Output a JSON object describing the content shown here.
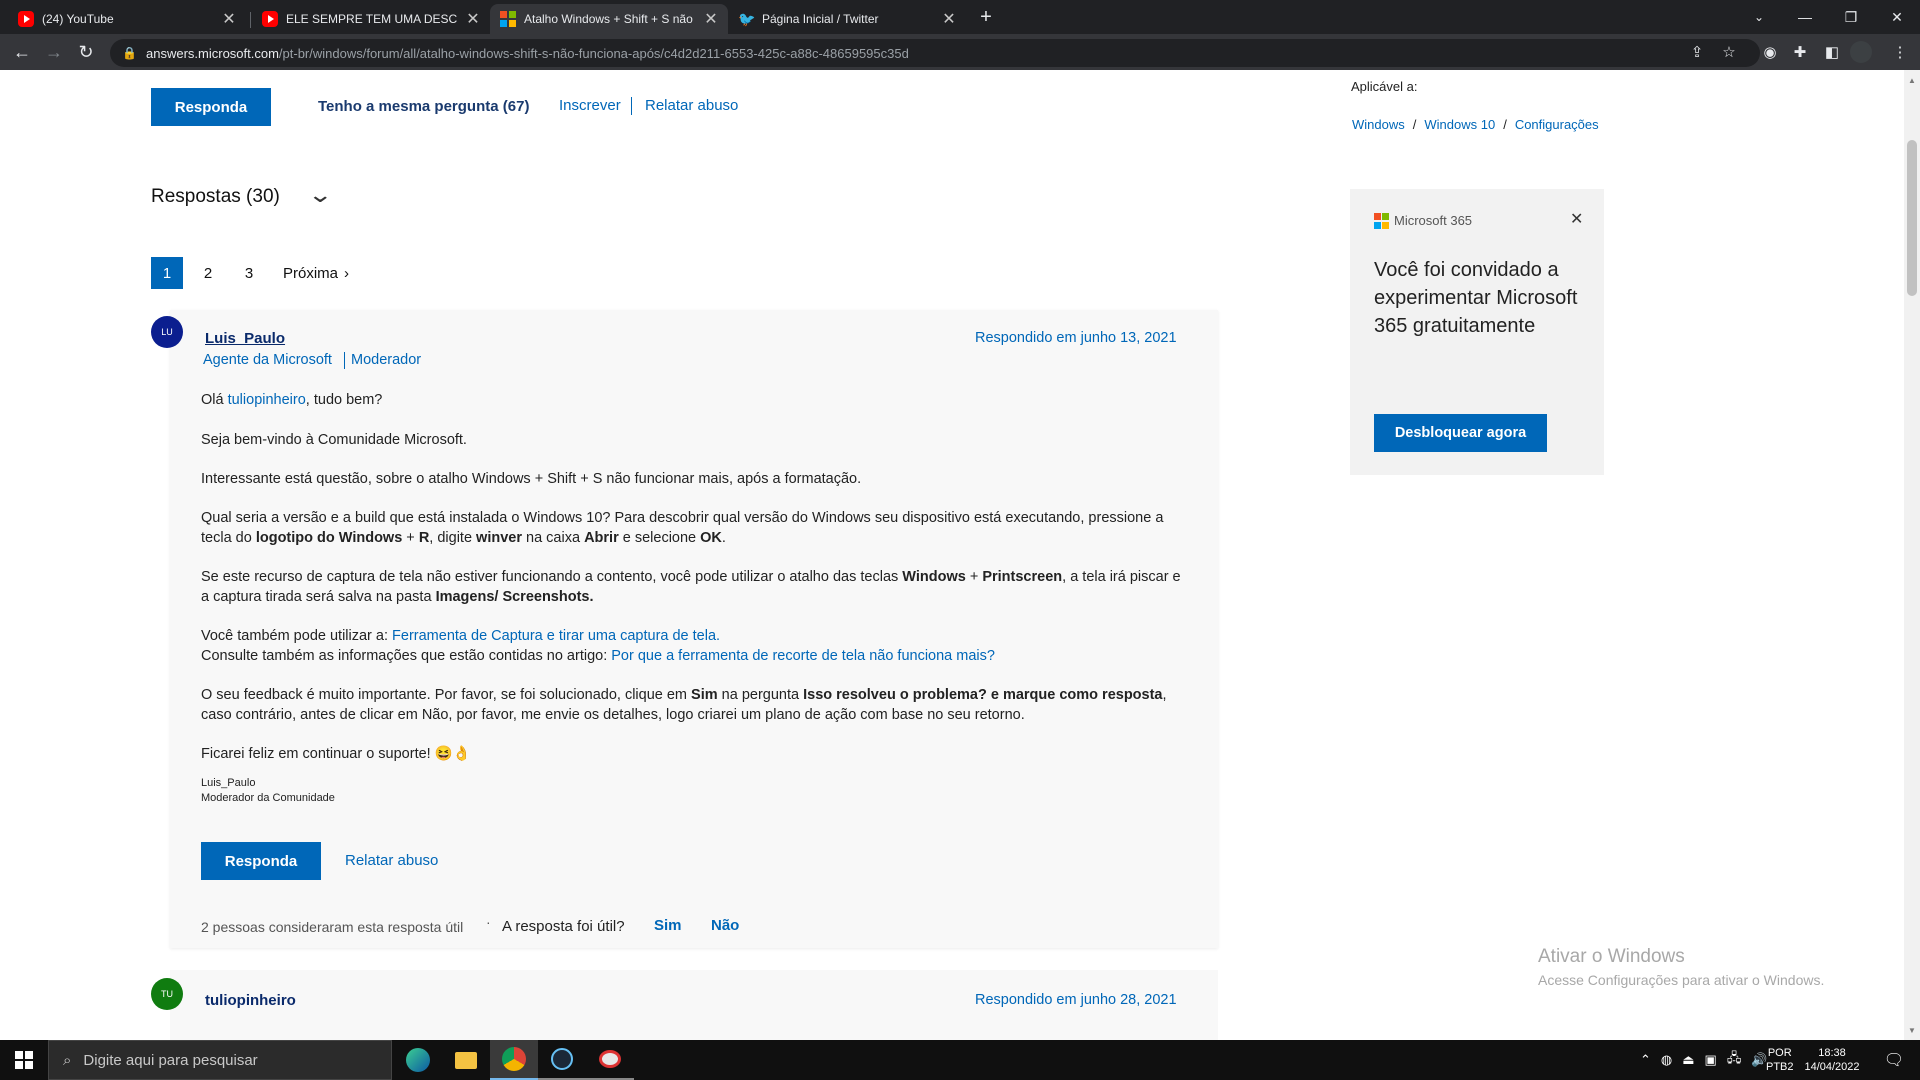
{
  "browser": {
    "tabs": [
      {
        "title": "(24) YouTube",
        "icon": "youtube-icon"
      },
      {
        "title": "ELE SEMPRE TEM UMA DESCULPA",
        "icon": "youtube-icon"
      },
      {
        "title": "Atalho Windows + Shift + S não funciona após",
        "icon": "microsoft-icon"
      },
      {
        "title": "Página Inicial / Twitter",
        "icon": "twitter-icon"
      }
    ],
    "url_host": "answers.microsoft.com",
    "url_path": "/pt-br/windows/forum/all/atalho-windows-shift-s-não-funciona-após/c4d2d211-6553-425c-a88c-48659595c35d"
  },
  "question_actions": {
    "reply": "Responda",
    "same_question": "Tenho a mesma pergunta (67)",
    "subscribe": "Inscrever",
    "report": "Relatar abuso"
  },
  "sidebar": {
    "applies_to": "Aplicável a:",
    "breadcrumbs": [
      "Windows",
      "Windows 10",
      "Configurações"
    ],
    "ad": {
      "brand": "Microsoft 365",
      "headline": "Você foi convidado a experimentar Microsoft 365 gratuitamente",
      "cta": "Desbloquear agora"
    }
  },
  "replies": {
    "heading": "Respostas (30)",
    "pages": [
      "1",
      "2",
      "3"
    ],
    "next": "Próxima"
  },
  "post1": {
    "avatar": "LU",
    "author": "Luis_Paulo",
    "role_agent": "Agente da Microsoft",
    "role_mod": "Moderador",
    "date": "Respondido em junho 13, 2021",
    "greeting_pre": "Olá ",
    "greeting_user": "tuliopinheiro",
    "greeting_post": ", tudo bem?",
    "p_welcome": "Seja bem-vindo à Comunidade Microsoft.",
    "p_interest": "Interessante está questão, sobre o atalho Windows + Shift + S não funcionar mais, após a formatação.",
    "p_version_1": "Qual seria a versão e a build que está instalada o Windows 10? Para descobrir qual versão do Windows seu dispositivo está executando, pressione a tecla do ",
    "p_version_b1": "logotipo do Windows",
    "p_version_2": "  + ",
    "p_version_b2": "R",
    "p_version_3": ", digite ",
    "p_version_b3": "winver",
    "p_version_4": " na caixa ",
    "p_version_b4": "Abrir",
    "p_version_5": " e selecione ",
    "p_version_b5": "OK",
    "p_version_6": ".",
    "p_capture_1": "Se este recurso de captura de tela não estiver funcionando a contento, você pode utilizar o atalho das teclas ",
    "p_capture_b1": "Windows",
    "p_capture_2": " + ",
    "p_capture_b2": "Printscreen",
    "p_capture_3": ", a tela irá piscar e a captura tirada será salva na pasta ",
    "p_capture_b3": "Imagens/ Screenshots.",
    "p_tool_pre": "Você também pode utilizar a: ",
    "p_tool_link": "Ferramenta de Captura e tirar uma captura de tela.",
    "p_article_pre": "Consulte também as informações que estão contidas no artigo: ",
    "p_article_link": "Por que a ferramenta de recorte de tela não funciona mais?",
    "p_feedback_1": "O seu feedback é muito importante. Por favor, se foi solucionado, clique em ",
    "p_feedback_b1": "Sim",
    "p_feedback_2": " na pergunta ",
    "p_feedback_b2": "Isso resolveu o problema? e marque como resposta",
    "p_feedback_3": ", caso contrário, antes de clicar em Não, por favor, me envie os detalhes, logo criarei um plano de ação com base no seu retorno.",
    "p_happy": "Ficarei feliz em continuar o suporte! 😆👌",
    "sig_name": "Luis_Paulo",
    "sig_role": "Moderador da Comunidade",
    "reply": "Responda",
    "report": "Relatar abuso",
    "helpful_count": "2 pessoas consideraram esta resposta útil",
    "helpful_q": "A resposta foi útil?",
    "yes": "Sim",
    "no": "Não"
  },
  "post2": {
    "avatar": "TU",
    "author": "tuliopinheiro",
    "date": "Respondido em junho 28, 2021"
  },
  "watermark": {
    "title": "Ativar o Windows",
    "sub": "Acesse Configurações para ativar o Windows."
  },
  "taskbar": {
    "search": "Digite aqui para pesquisar",
    "lang": "POR",
    "layout": "PTB2",
    "time": "18:38",
    "date": "14/04/2022"
  },
  "colors": {
    "accent": "#0067b8",
    "avatar_lu": "#0b1e8f",
    "avatar_tu": "#107c10"
  }
}
